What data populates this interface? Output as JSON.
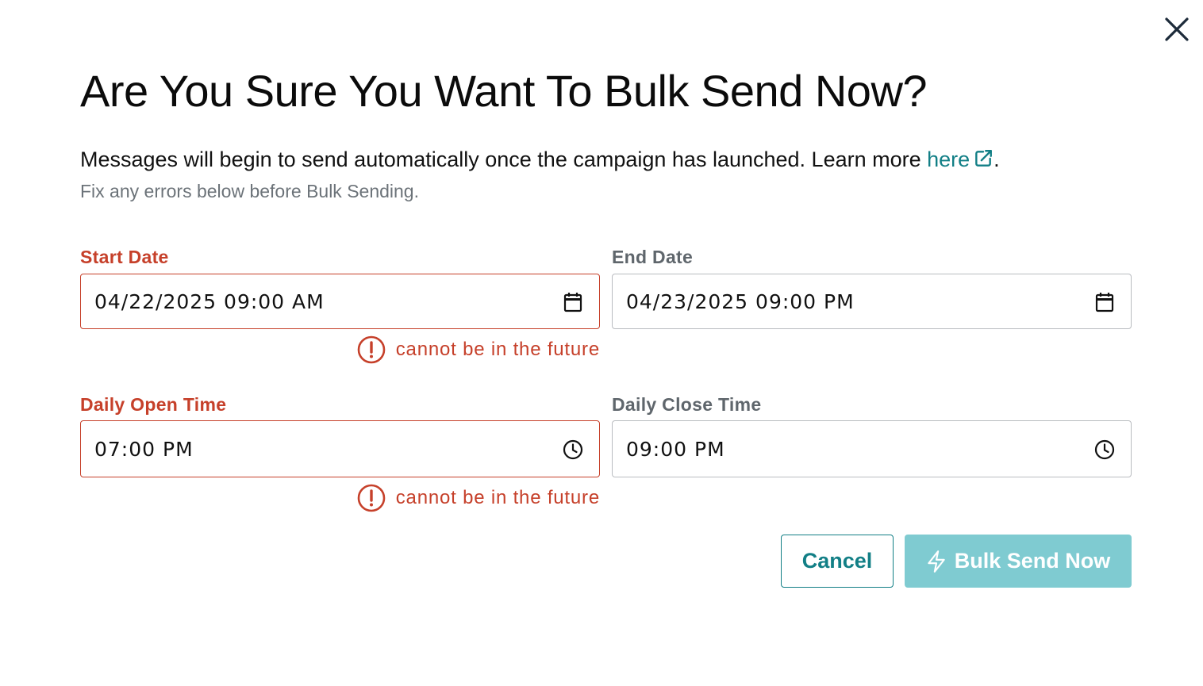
{
  "dialog": {
    "title": "Are You Sure You Want To Bulk Send Now?",
    "description": "Messages will begin to send automatically once the campaign has launched. Learn more ",
    "link_text": "here",
    "description_end": ".",
    "subtext": "Fix any errors below before Bulk Sending."
  },
  "fields": {
    "start_date": {
      "label": "Start Date",
      "value": "04/22/2025 09:00 AM",
      "error": "cannot be in the future",
      "icon": "calendar-icon"
    },
    "end_date": {
      "label": "End Date",
      "value": "04/23/2025 09:00 PM",
      "icon": "calendar-icon"
    },
    "daily_open_time": {
      "label": "Daily Open Time",
      "value": "07:00 PM",
      "error": "cannot be in the future",
      "icon": "clock-icon"
    },
    "daily_close_time": {
      "label": "Daily Close Time",
      "value": "09:00 PM",
      "icon": "clock-icon"
    }
  },
  "buttons": {
    "cancel_label": "Cancel",
    "send_label": "Bulk Send Now"
  },
  "colors": {
    "error": "#c6402a",
    "accent": "#127f86",
    "disabled_primary": "#7fcbd1",
    "muted_text": "#6c7379"
  }
}
